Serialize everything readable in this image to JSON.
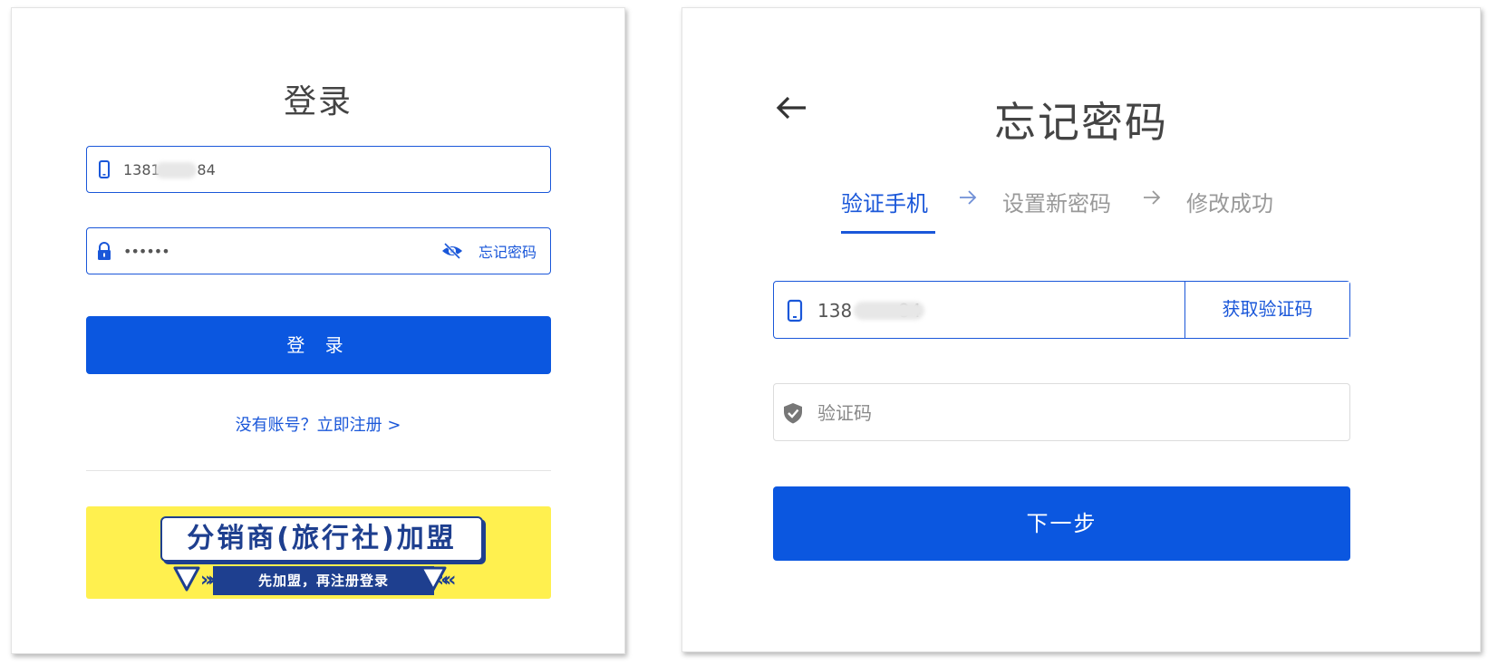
{
  "login": {
    "title": "登录",
    "phone_value": "1381        84",
    "password_value": "••••••",
    "forgot_label": "忘记密码",
    "submit_label": "登 录",
    "register_label": "没有账号？立即注册 >",
    "banner": {
      "title": "分销商(旅行社)加盟",
      "subtitle": "先加盟，再注册登录",
      "background_color": "#fff04f",
      "accent_color": "#1e3f8f"
    }
  },
  "forgot": {
    "title": "忘记密码",
    "steps": [
      {
        "label": "验证手机",
        "active": true
      },
      {
        "label": "设置新密码",
        "active": false
      },
      {
        "label": "修改成功",
        "active": false
      }
    ],
    "phone_value": "138        84",
    "get_code_label": "获取验证码",
    "code_placeholder": "验证码",
    "next_label": "下一步"
  },
  "colors": {
    "primary": "#0b57e0",
    "link": "#1a57d9",
    "inactive_step": "#999999"
  },
  "icons": [
    "phone-icon",
    "lock-icon",
    "eye-icon",
    "back-arrow-icon",
    "step-arrow-icon",
    "shield-check-icon"
  ]
}
